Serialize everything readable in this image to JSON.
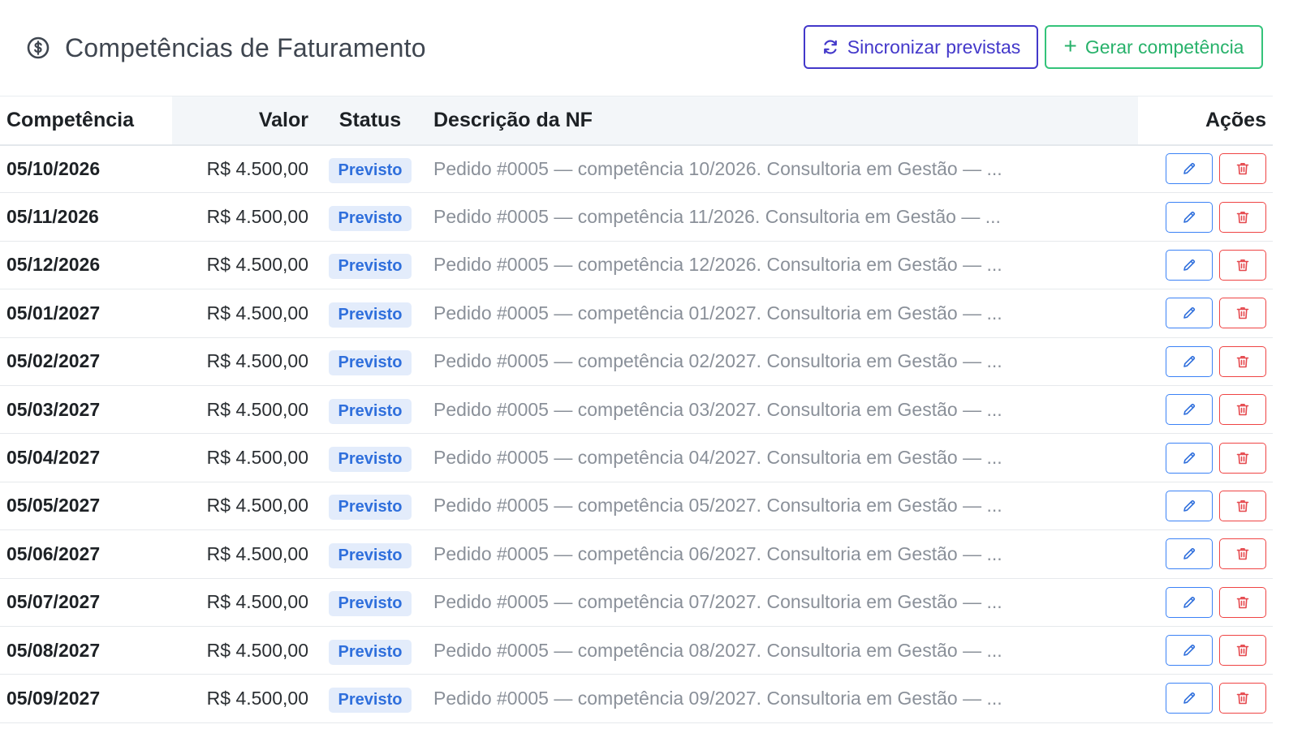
{
  "header": {
    "title": "Competências de Faturamento",
    "title_icon": "dollar-circle-icon",
    "sync_button_label": "Sincronizar previstas",
    "generate_button_label": "Gerar competência",
    "generate_button_prefix": "+"
  },
  "table": {
    "columns": [
      "Competência",
      "Valor",
      "Status",
      "Descrição da NF",
      "Ações"
    ],
    "rows": [
      {
        "competencia": "05/10/2026",
        "valor": "R$ 4.500,00",
        "status": "Previsto",
        "descricao": "Pedido #0005 — competência 10/2026. Consultoria em Gestão — ..."
      },
      {
        "competencia": "05/11/2026",
        "valor": "R$ 4.500,00",
        "status": "Previsto",
        "descricao": "Pedido #0005 — competência 11/2026. Consultoria em Gestão — ..."
      },
      {
        "competencia": "05/12/2026",
        "valor": "R$ 4.500,00",
        "status": "Previsto",
        "descricao": "Pedido #0005 — competência 12/2026. Consultoria em Gestão — ..."
      },
      {
        "competencia": "05/01/2027",
        "valor": "R$ 4.500,00",
        "status": "Previsto",
        "descricao": "Pedido #0005 — competência 01/2027. Consultoria em Gestão — ..."
      },
      {
        "competencia": "05/02/2027",
        "valor": "R$ 4.500,00",
        "status": "Previsto",
        "descricao": "Pedido #0005 — competência 02/2027. Consultoria em Gestão — ..."
      },
      {
        "competencia": "05/03/2027",
        "valor": "R$ 4.500,00",
        "status": "Previsto",
        "descricao": "Pedido #0005 — competência 03/2027. Consultoria em Gestão — ..."
      },
      {
        "competencia": "05/04/2027",
        "valor": "R$ 4.500,00",
        "status": "Previsto",
        "descricao": "Pedido #0005 — competência 04/2027. Consultoria em Gestão — ..."
      },
      {
        "competencia": "05/05/2027",
        "valor": "R$ 4.500,00",
        "status": "Previsto",
        "descricao": "Pedido #0005 — competência 05/2027. Consultoria em Gestão — ..."
      },
      {
        "competencia": "05/06/2027",
        "valor": "R$ 4.500,00",
        "status": "Previsto",
        "descricao": "Pedido #0005 — competência 06/2027. Consultoria em Gestão — ..."
      },
      {
        "competencia": "05/07/2027",
        "valor": "R$ 4.500,00",
        "status": "Previsto",
        "descricao": "Pedido #0005 — competência 07/2027. Consultoria em Gestão — ..."
      },
      {
        "competencia": "05/08/2027",
        "valor": "R$ 4.500,00",
        "status": "Previsto",
        "descricao": "Pedido #0005 — competência 08/2027. Consultoria em Gestão — ..."
      },
      {
        "competencia": "05/09/2027",
        "valor": "R$ 4.500,00",
        "status": "Previsto",
        "descricao": "Pedido #0005 — competência 09/2027. Consultoria em Gestão — ..."
      }
    ],
    "row_actions": [
      "pencil-icon",
      "trash-icon"
    ]
  },
  "colors": {
    "sync_button": "#4338ca",
    "generate_button": "#28b26b",
    "badge_text": "#2f6fdc",
    "badge_bg": "#e3ecfb",
    "edit_action": "#3b82f6",
    "delete_action": "#ef4444",
    "description_text": "#8a9099"
  }
}
